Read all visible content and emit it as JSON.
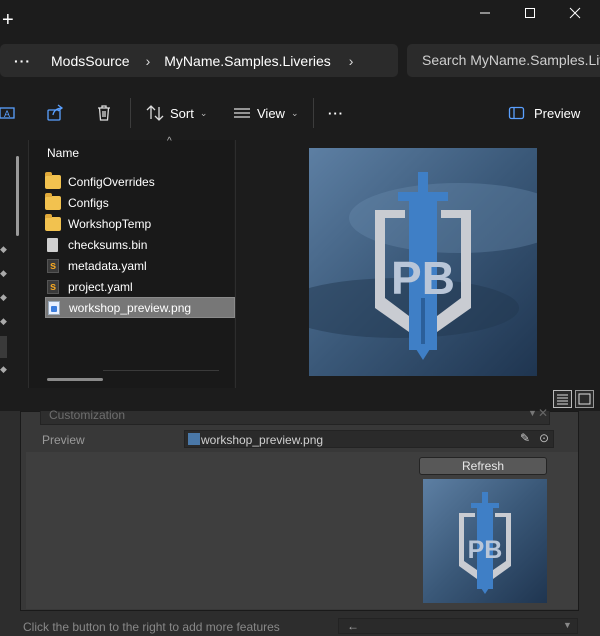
{
  "titlebar": {
    "new_tab": "+",
    "minimize": "—",
    "maximize": "☐",
    "close": "✕"
  },
  "address": {
    "more": "···",
    "crumbs": [
      "ModsSource",
      "MyName.Samples.Liveries"
    ],
    "separator": "›"
  },
  "search": {
    "placeholder": "Search MyName.Samples.Liveries"
  },
  "toolbar": {
    "sort_label": "Sort",
    "view_label": "View",
    "more_label": "···",
    "preview_label": "Preview"
  },
  "filelist": {
    "column_name": "Name",
    "items": [
      {
        "name": "ConfigOverrides",
        "type": "folder"
      },
      {
        "name": "Configs",
        "type": "folder"
      },
      {
        "name": "WorkshopTemp",
        "type": "folder"
      },
      {
        "name": "checksums.bin",
        "type": "file"
      },
      {
        "name": "metadata.yaml",
        "type": "yaml"
      },
      {
        "name": "project.yaml",
        "type": "yaml"
      },
      {
        "name": "workshop_preview.png",
        "type": "png",
        "selected": true
      }
    ]
  },
  "preview_image": {
    "logo_text": "PB"
  },
  "inspector": {
    "customization_placeholder": "Customization",
    "preview_label": "Preview",
    "preview_value": "workshop_preview.png",
    "refresh_label": "Refresh",
    "hint": "Click the button to the right to add more features",
    "add_feature_value": "←"
  },
  "colors": {
    "accent": "#3b7ddd",
    "logo": "#3f7fc6",
    "selection": "#777777"
  }
}
